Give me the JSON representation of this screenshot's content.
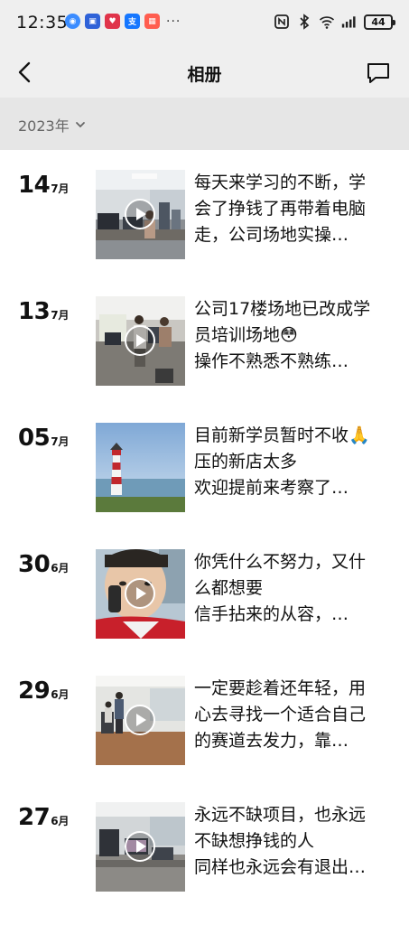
{
  "status_bar": {
    "time": "12:35",
    "more": "···",
    "battery": "44"
  },
  "header": {
    "title": "相册"
  },
  "filter": {
    "year": "2023年"
  },
  "posts": [
    {
      "day": "14",
      "month": "7月",
      "lines": [
        "每天来学习的不断，学",
        "会了挣钱了再带着电脑",
        "走，公司场地实操…"
      ],
      "has_video": true
    },
    {
      "day": "13",
      "month": "7月",
      "lines": [
        "公司17楼场地已改成学",
        "员培训场地😳",
        "操作不熟悉不熟练…"
      ],
      "has_video": true
    },
    {
      "day": "05",
      "month": "7月",
      "lines": [
        "目前新学员暂时不收🙏",
        "压的新店太多",
        "欢迎提前来考察了…"
      ],
      "has_video": false
    },
    {
      "day": "30",
      "month": "6月",
      "lines": [
        "你凭什么不努力，又什",
        "么都想要",
        "信手拈来的从容，…"
      ],
      "has_video": true
    },
    {
      "day": "29",
      "month": "6月",
      "lines": [
        "一定要趁着还年轻，用",
        "心去寻找一个适合自己",
        "的赛道去发力，靠…"
      ],
      "has_video": true
    },
    {
      "day": "27",
      "month": "6月",
      "lines": [
        "永远不缺项目，也永远",
        "不缺想挣钱的人",
        "同样也永远会有退出…"
      ],
      "has_video": true
    }
  ]
}
